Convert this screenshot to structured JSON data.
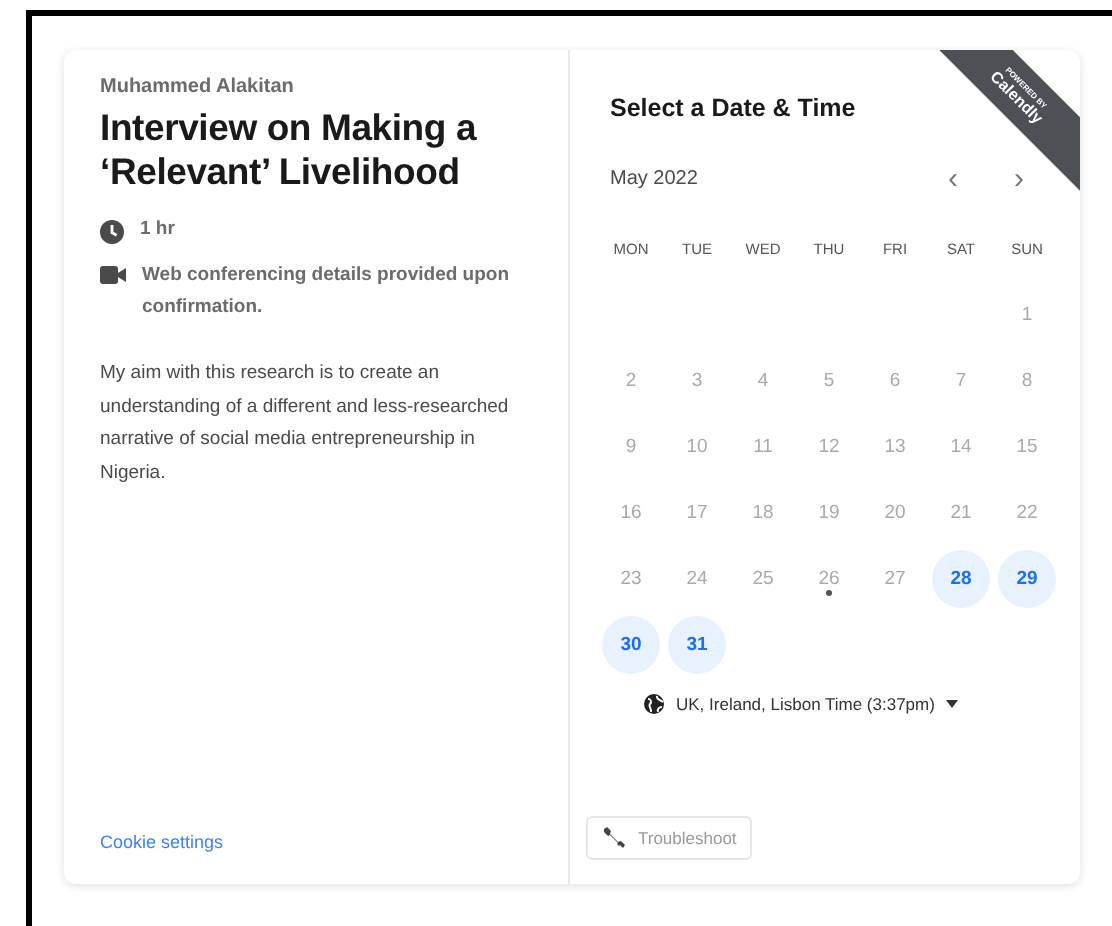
{
  "event": {
    "organizer": "Muhammed Alakitan",
    "title": "Interview on Making a ‘Relevant’ Livelihood",
    "details": [
      {
        "kind": "duration",
        "text": "1 hr"
      },
      {
        "kind": "video",
        "text": "Web conferencing details provided upon confirmation."
      }
    ],
    "description": "My aim with this research is to create an understanding of a different and less-researched narrative of social media entrepreneurship in Nigeria.",
    "cookie_link": "Cookie settings"
  },
  "calendar": {
    "heading": "Select a Date & Time",
    "month": "May 2022",
    "prev": "‹",
    "next": "›",
    "ribbon": {
      "top": "POWERED BY",
      "brand": "Calendly"
    },
    "weekdays": [
      "MON",
      "TUE",
      "WED",
      "THU",
      "FRI",
      "SAT",
      "SUN"
    ],
    "weeks": [
      [
        {
          "day": "1",
          "available": false,
          "today": false
        }
      ],
      [
        {
          "day": "2",
          "available": false,
          "today": false
        },
        {
          "day": "3",
          "available": false,
          "today": false
        },
        {
          "day": "4",
          "available": false,
          "today": false
        },
        {
          "day": "5",
          "available": false,
          "today": false
        },
        {
          "day": "6",
          "available": false,
          "today": false
        },
        {
          "day": "7",
          "available": false,
          "today": false
        },
        {
          "day": "8",
          "available": false,
          "today": false
        }
      ],
      [
        {
          "day": "9",
          "available": false,
          "today": false
        },
        {
          "day": "10",
          "available": false,
          "today": false
        },
        {
          "day": "11",
          "available": false,
          "today": false
        },
        {
          "day": "12",
          "available": false,
          "today": false
        },
        {
          "day": "13",
          "available": false,
          "today": false
        },
        {
          "day": "14",
          "available": false,
          "today": false
        },
        {
          "day": "15",
          "available": false,
          "today": false
        }
      ],
      [
        {
          "day": "16",
          "available": false,
          "today": false
        },
        {
          "day": "17",
          "available": false,
          "today": false
        },
        {
          "day": "18",
          "available": false,
          "today": false
        },
        {
          "day": "19",
          "available": false,
          "today": false
        },
        {
          "day": "20",
          "available": false,
          "today": false
        },
        {
          "day": "21",
          "available": false,
          "today": false
        },
        {
          "day": "22",
          "available": false,
          "today": false
        }
      ],
      [
        {
          "day": "23",
          "available": false,
          "today": false
        },
        {
          "day": "24",
          "available": false,
          "today": false
        },
        {
          "day": "25",
          "available": false,
          "today": false
        },
        {
          "day": "26",
          "available": false,
          "today": true
        },
        {
          "day": "27",
          "available": false,
          "today": false
        },
        {
          "day": "28",
          "available": true,
          "today": false
        },
        {
          "day": "29",
          "available": true,
          "today": false
        }
      ],
      [
        {
          "day": "30",
          "available": true,
          "today": false
        },
        {
          "day": "31",
          "available": true,
          "today": false
        }
      ]
    ],
    "timezone": "UK, Ireland, Lisbon Time (3:37pm)",
    "troubleshoot": "Troubleshoot"
  }
}
